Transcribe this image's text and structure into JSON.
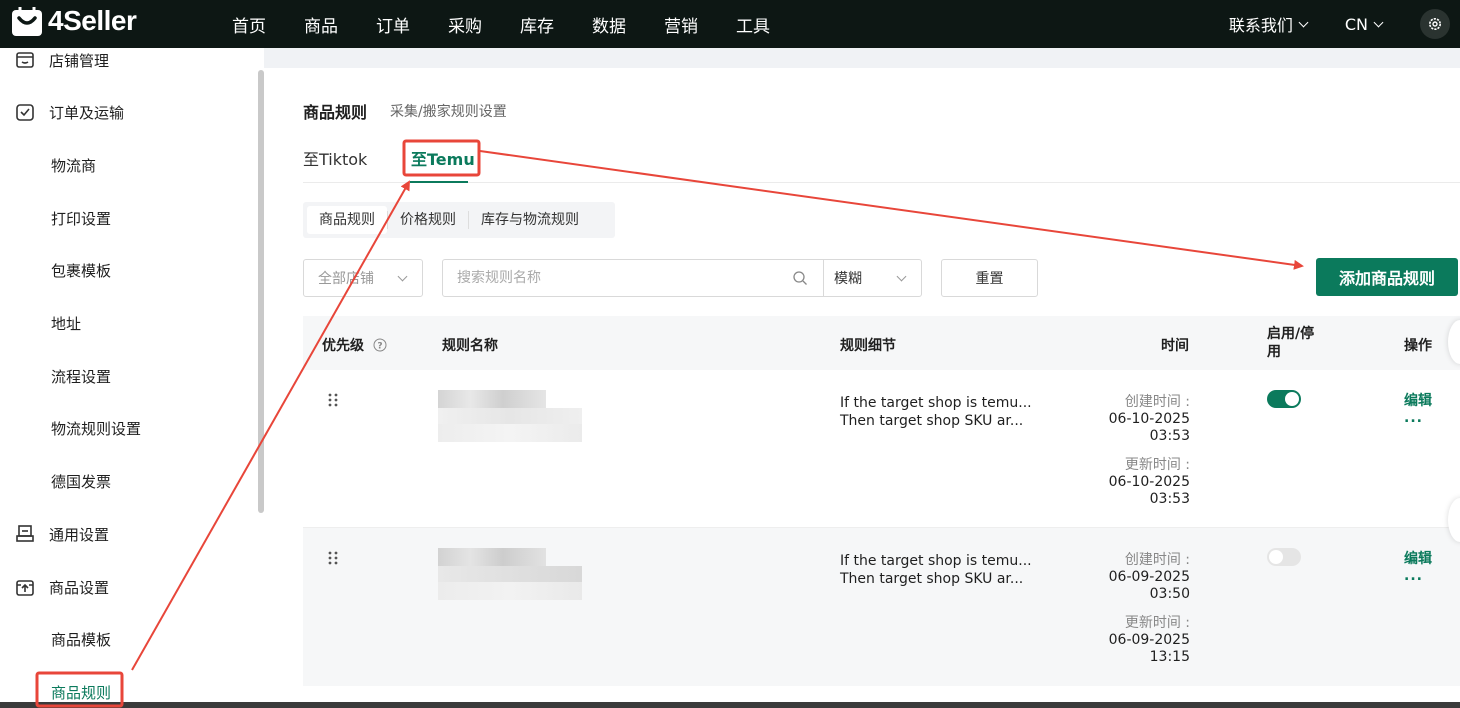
{
  "app": {
    "name": "4Seller"
  },
  "nav": [
    "首页",
    "商品",
    "订单",
    "采购",
    "库存",
    "数据",
    "营销",
    "工具"
  ],
  "topright": {
    "contact": "联系我们",
    "lang": "CN"
  },
  "sidebar": {
    "items": [
      {
        "label": "店铺管理",
        "kind": "group",
        "icon": "store-icon"
      },
      {
        "label": "订单及运输",
        "kind": "group",
        "icon": "order-check-icon"
      },
      {
        "label": "物流商",
        "kind": "sub"
      },
      {
        "label": "打印设置",
        "kind": "sub"
      },
      {
        "label": "包裹模板",
        "kind": "sub"
      },
      {
        "label": "地址",
        "kind": "sub"
      },
      {
        "label": "流程设置",
        "kind": "sub"
      },
      {
        "label": "物流规则设置",
        "kind": "sub"
      },
      {
        "label": "德国发票",
        "kind": "sub"
      },
      {
        "label": "通用设置",
        "kind": "group",
        "icon": "printer-icon"
      },
      {
        "label": "商品设置",
        "kind": "group",
        "icon": "product-upload-icon"
      },
      {
        "label": "商品模板",
        "kind": "sub"
      },
      {
        "label": "商品规则",
        "kind": "sub",
        "active": true
      }
    ]
  },
  "page": {
    "title": "商品规则",
    "subtitle": "采集/搬家规则设置",
    "tabs": [
      "至Tiktok",
      "至Temu"
    ],
    "subtabs": [
      "商品规则",
      "价格规则",
      "库存与物流规则"
    ]
  },
  "filters": {
    "shop_placeholder": "全部店铺",
    "search_placeholder": "搜索规则名称",
    "mode": "模糊",
    "reset_label": "重置",
    "add_label": "添加商品规则"
  },
  "table": {
    "headers": {
      "priority": "优先级",
      "name": "规则名称",
      "detail": "规则细节",
      "time": "时间",
      "enable": "启用/停用",
      "ops": "操作"
    },
    "rows": [
      {
        "detail_line1": "If the target shop is temu...",
        "detail_line2": "Then target shop SKU ar...",
        "created_label": "创建时间 :",
        "created_date": "06-10-2025",
        "created_time": "03:53",
        "updated_label": "更新时间 :",
        "updated_date": "06-10-2025",
        "updated_time": "03:53",
        "enabled": true,
        "edit": "编辑",
        "more": "..."
      },
      {
        "detail_line1": "If the target shop is temu...",
        "detail_line2": "Then target shop SKU ar...",
        "created_label": "创建时间 :",
        "created_date": "06-09-2025",
        "created_time": "03:50",
        "updated_label": "更新时间 :",
        "updated_date": "06-09-2025",
        "updated_time": "13:15",
        "enabled": false,
        "edit": "编辑",
        "more": "..."
      }
    ]
  },
  "colors": {
    "brand": "#0b7a5c",
    "topbar": "#0d1714",
    "annotation": "#e8463a"
  }
}
